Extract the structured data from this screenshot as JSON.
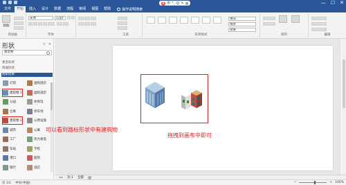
{
  "window": {
    "minimize": "—",
    "maximize": "☐",
    "close": "✕"
  },
  "ime": {
    "logo": "S",
    "items": [
      "中",
      "°,",
      "☺",
      "✎"
    ]
  },
  "ribbon_tabs": [
    "文件",
    "开始",
    "插入",
    "设计",
    "数据",
    "流程",
    "审阅",
    "视图",
    "帮助"
  ],
  "active_tab_index": 1,
  "tell_me": "操作说明搜索",
  "ribbon": {
    "paste_label": "粘贴",
    "font_name": "宋体",
    "font_size": "12pt",
    "clipboard_label": "剪贴板",
    "font_label": "字体",
    "tools_label": "工具",
    "shape_styles_label": "形状样式",
    "arrange_label": "排列",
    "editing_label": "编辑",
    "extra_labels": [
      "填充",
      "线条",
      "效果"
    ]
  },
  "shapes_pane": {
    "title": "形状",
    "search_text": "建筑物",
    "link_more": "更多形状",
    "link_quick": "快速形状",
    "result_label": "搜索结果",
    "items": [
      {
        "label": "灯塔",
        "color": "#8a9bb0"
      },
      {
        "label": "国际酒店",
        "color": "#b07a4a"
      },
      {
        "label": "建筑物 1",
        "color": "#6a8fb5",
        "highlight": true
      },
      {
        "label": "国际酒店",
        "color": "#c46a5a"
      },
      {
        "label": "公园",
        "color": "#5ea060"
      },
      {
        "label": "体育馆",
        "color": "#9a9a9a"
      },
      {
        "label": "仓库",
        "color": "#a07850"
      },
      {
        "label": "停车场",
        "color": "#7a7a9a"
      },
      {
        "label": "建筑物 2",
        "color": "#c04a3a",
        "highlight": true
      },
      {
        "label": "公用设施",
        "color": "#8a8a8a"
      },
      {
        "label": "城市",
        "color": "#6a8aa0"
      },
      {
        "label": "公寓",
        "color": "#b08a60"
      },
      {
        "label": "工厂",
        "color": "#9a6a5a"
      },
      {
        "label": "风力发电",
        "color": "#7aa07a"
      },
      {
        "label": "车站",
        "color": "#8a7a6a"
      },
      {
        "label": "学校",
        "color": "#a0a060"
      },
      {
        "label": "港口",
        "color": "#5a7aa0"
      },
      {
        "label": "医院",
        "color": "#c06060"
      },
      {
        "label": "银行",
        "color": "#7a9a8a"
      },
      {
        "label": "酒店",
        "color": "#b09070"
      }
    ]
  },
  "annotations": {
    "left": "可以看到路标形状中有建筑物",
    "right": "拖拽到画布中即可"
  },
  "page_tabs": {
    "page_name": "页-1",
    "all_pages": "全部"
  },
  "status": {
    "page_info": "页 1/1",
    "language": "中文(中国)",
    "zoom": "100%"
  },
  "colors": {
    "accent": "#2b579a",
    "annotation": "#e02020"
  }
}
